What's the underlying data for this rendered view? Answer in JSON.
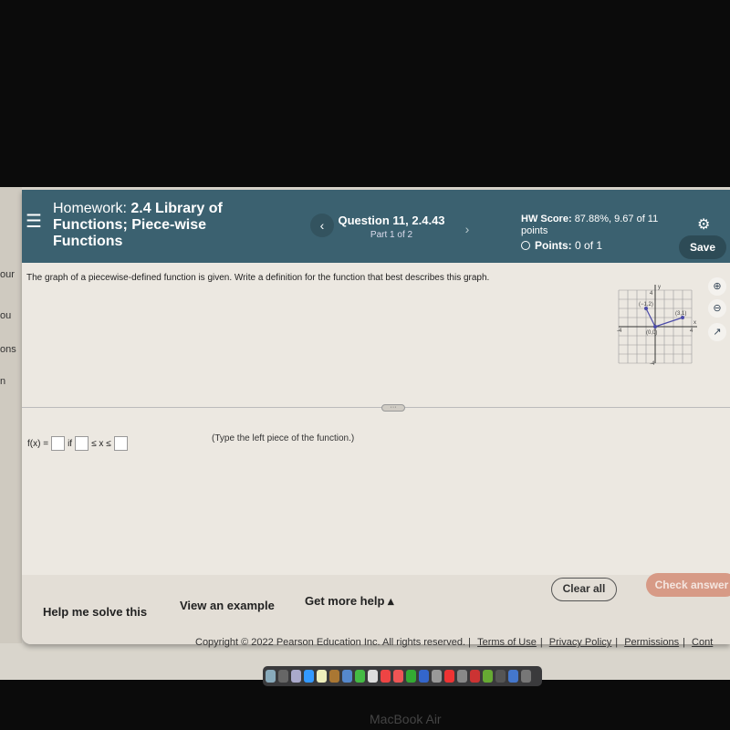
{
  "left_strip": [
    "our",
    "ou",
    "ons",
    "n"
  ],
  "header": {
    "menu_icon": "hamburger-icon",
    "homework_prefix": "Homework:",
    "homework_title": "2.4 Library of Functions; Piece-wise Functions",
    "question": "Question 11, 2.4.43",
    "part": "Part 1 of 2",
    "hw_score_label": "HW Score:",
    "hw_score_value": "87.88%, 9.67 of 11 points",
    "points_label": "Points:",
    "points_value": "0 of 1",
    "save_label": "Save"
  },
  "question_text": "The graph of a piecewise-defined function is given. Write a definition for the function that best describes this graph.",
  "graph": {
    "x_label": "x",
    "y_label": "y",
    "xlim": [
      -4,
      4
    ],
    "ylim": [
      -4,
      4
    ],
    "tick_labels": {
      "x_min": "-4",
      "x_max": "4",
      "y_max": "4",
      "y_min": "-4"
    },
    "points": [
      {
        "x": -1,
        "y": 2,
        "label": "(−1,2)"
      },
      {
        "x": 0,
        "y": 0,
        "label": "(0,0)"
      },
      {
        "x": 3,
        "y": 1,
        "label": "(3,1)"
      }
    ],
    "line_color": "#4a4aa8"
  },
  "tools": [
    "zoom-in-icon",
    "zoom-out-icon",
    "external-link-icon"
  ],
  "answer": {
    "fx": "f(x) =",
    "if": "if",
    "le": "≤ x ≤",
    "hint": "(Type the left piece of the function.)"
  },
  "footer": {
    "help": "Help me solve this",
    "example": "View an example",
    "more": "Get more help ▴",
    "clear": "Clear all",
    "check": "Check answer"
  },
  "copyright": {
    "text": "Copyright © 2022 Pearson Education Inc. All rights reserved. |",
    "links": [
      "Terms of Use",
      "Privacy Policy",
      "Permissions",
      "Cont"
    ]
  },
  "device": "MacBook Air"
}
